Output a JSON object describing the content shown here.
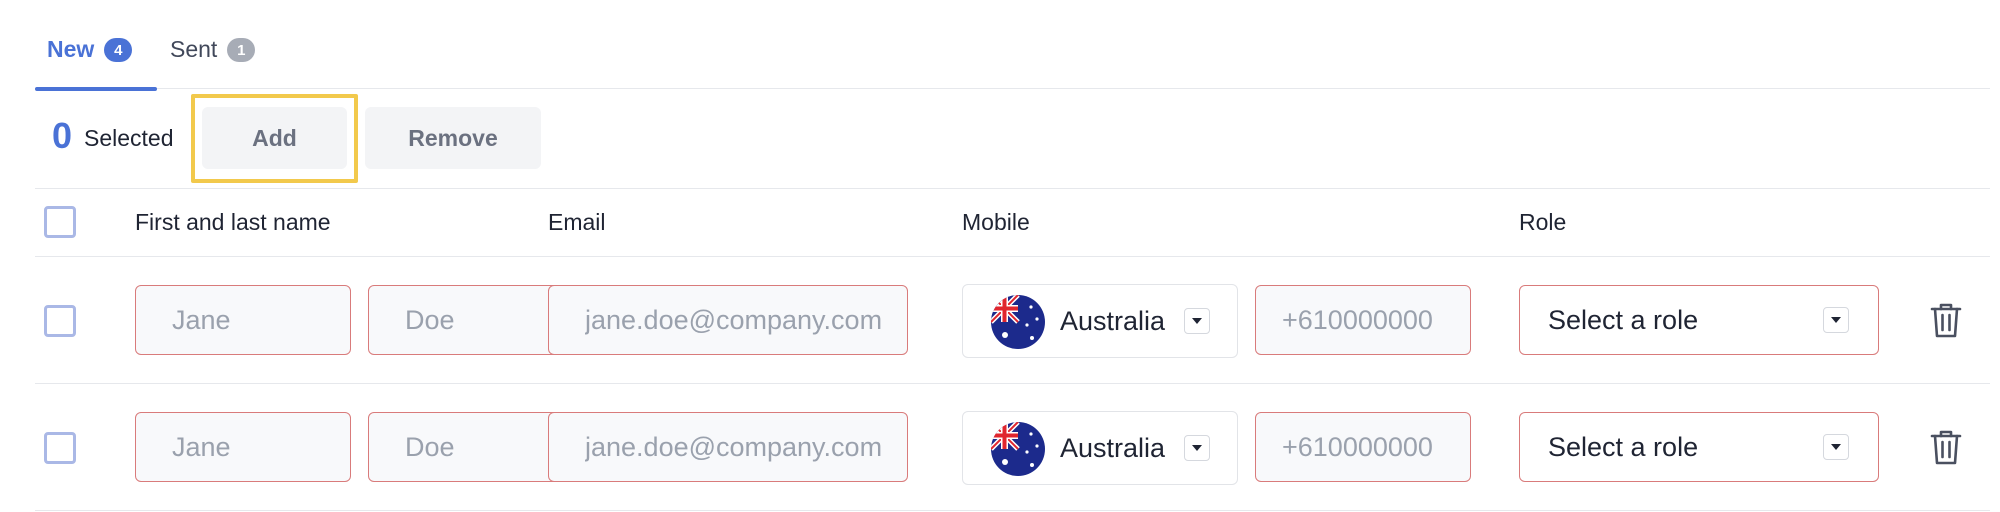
{
  "tabs": [
    {
      "label": "New",
      "count": "4"
    },
    {
      "label": "Sent",
      "count": "1"
    }
  ],
  "toolbar": {
    "selected_count": "0",
    "selected_label": "Selected",
    "add_label": "Add",
    "remove_label": "Remove"
  },
  "table": {
    "headers": {
      "name": "First and last name",
      "email": "Email",
      "mobile": "Mobile",
      "role": "Role"
    },
    "rows": [
      {
        "first_placeholder": "Jane",
        "last_placeholder": "Doe",
        "email_placeholder": "jane.doe@company.com",
        "country": "Australia",
        "phone_placeholder": "+610000000",
        "role": "Select a role"
      },
      {
        "first_placeholder": "Jane",
        "last_placeholder": "Doe",
        "email_placeholder": "jane.doe@company.com",
        "country": "Australia",
        "phone_placeholder": "+610000000",
        "role": "Select a role"
      }
    ]
  },
  "colors": {
    "accent": "#4a72d6",
    "error_border": "#d97b7b",
    "highlight": "#f2c94c"
  },
  "icons": [
    "australia-flag-icon",
    "chevron-down-icon",
    "trash-icon"
  ]
}
